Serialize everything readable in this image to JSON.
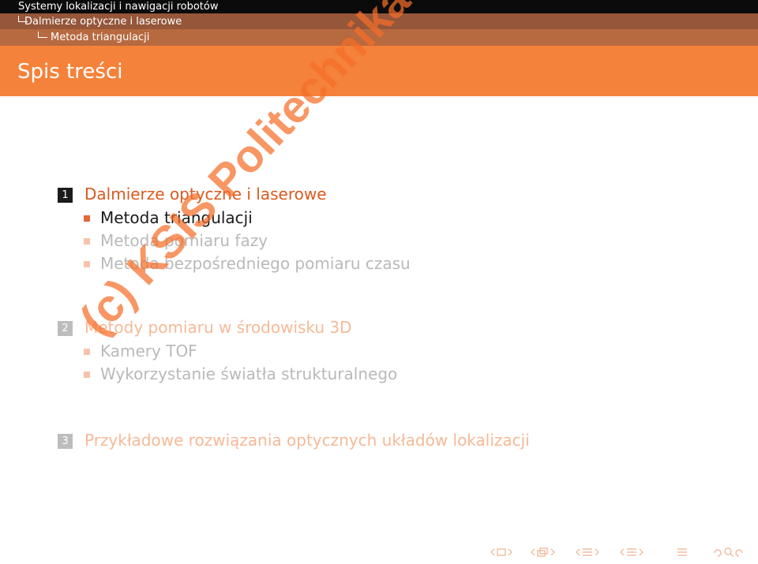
{
  "header": {
    "title": "Systemy lokalizacji i nawigacji robotów",
    "section": "Dalmierze optyczne i laserowe",
    "subsection": "Metoda triangulacji"
  },
  "frame": {
    "title": "Spis treści"
  },
  "toc": {
    "sections": [
      {
        "number": "1",
        "title": "Dalmierze optyczne i laserowe",
        "subsections": [
          "Metoda triangulacji",
          "Metoda pomiaru fazy",
          "Metoda bezpośredniego pomiaru czasu"
        ]
      },
      {
        "number": "2",
        "title": "Metody pomiaru w środowisku 3D",
        "subsections": [
          "Kamery TOF",
          "Wykorzystanie światła strukturalnego"
        ]
      },
      {
        "number": "3",
        "title": "Przykładowe rozwiązania optycznych układów lokalizacji",
        "subsections": []
      }
    ]
  },
  "watermark": "(c) KSIS Politechnika Poznanska",
  "nav_icons": [
    "left-arrow-icon",
    "slide-icon",
    "right-arrow-icon",
    "frame-icon",
    "section-icon",
    "subsection-icon",
    "toc-icon",
    "search-icon"
  ],
  "colors": {
    "accent": "#f5823a",
    "header_dark": "#0b0b0b",
    "header_mid": "#95563a",
    "header_light": "#b7693f"
  }
}
